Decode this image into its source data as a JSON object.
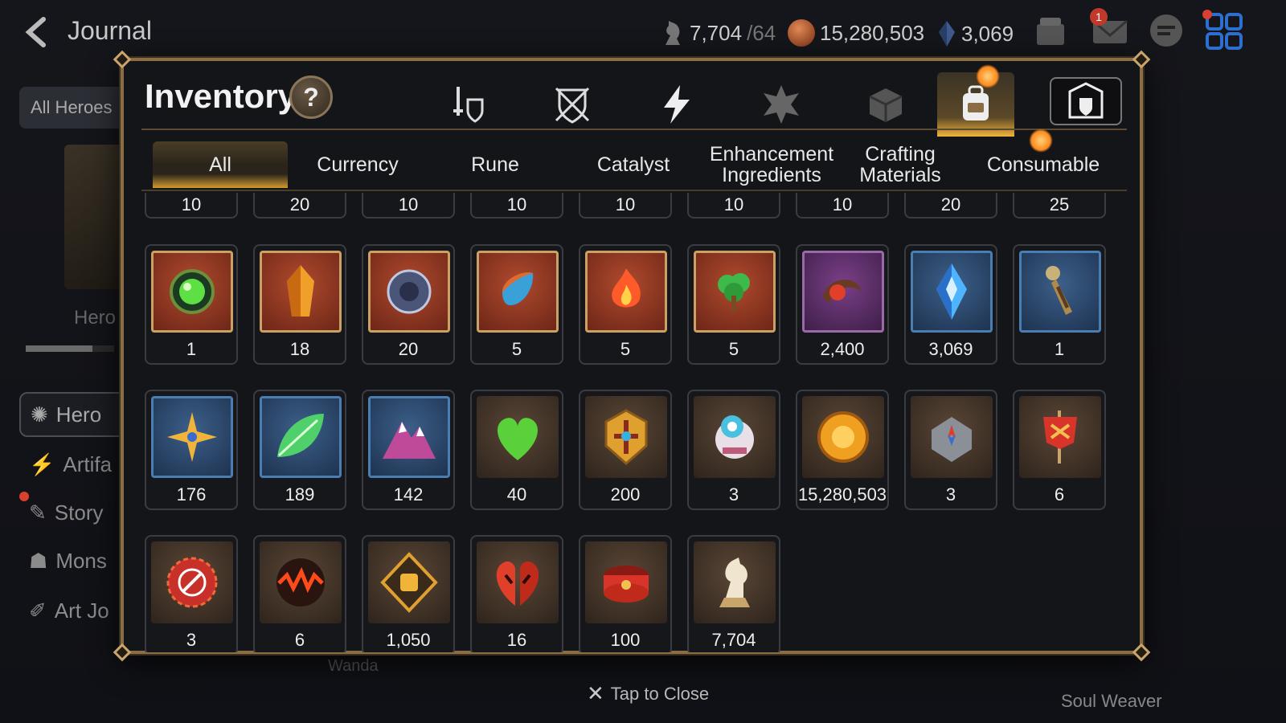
{
  "header": {
    "title": "Journal",
    "resources": [
      {
        "name": "skystone-like",
        "value": "7,704",
        "suffix": "/64",
        "icon": "horse-icon"
      },
      {
        "name": "gold",
        "value": "15,280,503",
        "icon": "gold-coin-icon"
      },
      {
        "name": "crystal",
        "value": "3,069",
        "icon": "crystal-icon"
      }
    ],
    "mail_badge": "1"
  },
  "background": {
    "all_heroes": "All Heroes",
    "hero_label": "Hero",
    "sidebar": [
      {
        "label": "Hero",
        "icon": "hero-icon"
      },
      {
        "label": "Artifa",
        "icon": "artifact-icon"
      },
      {
        "label": "Story",
        "icon": "story-icon"
      },
      {
        "label": "Mons",
        "icon": "monster-icon"
      },
      {
        "label": "Art Jo",
        "icon": "art-icon"
      }
    ],
    "wanda": "Wanda",
    "soul_weaver": "Soul Weaver",
    "tap_close": "Tap to Close"
  },
  "modal": {
    "title": "Inventory",
    "help": "?",
    "categories": [
      {
        "name": "equipment",
        "icon": "sword-shield-icon"
      },
      {
        "name": "gear",
        "icon": "crossed-shield-icon"
      },
      {
        "name": "artifact",
        "icon": "lightning-icon"
      },
      {
        "name": "material",
        "icon": "crest-icon"
      },
      {
        "name": "box",
        "icon": "cube-icon"
      },
      {
        "name": "bag",
        "icon": "backpack-icon",
        "active": true
      },
      {
        "name": "storage",
        "icon": "castle-shield-icon"
      }
    ],
    "tabs": [
      {
        "label": "All",
        "active": true
      },
      {
        "label": "Currency"
      },
      {
        "label": "Rune"
      },
      {
        "label": "Catalyst"
      },
      {
        "label": "Enhancement Ingredients"
      },
      {
        "label": "Crafting Materials"
      },
      {
        "label": "Consumable"
      }
    ],
    "top_row": [
      "10",
      "20",
      "10",
      "10",
      "10",
      "10",
      "10",
      "20",
      "25"
    ],
    "items": [
      {
        "qty": "1",
        "bg": "red",
        "frame": "gold",
        "icon": "green-orb-icon"
      },
      {
        "qty": "18",
        "bg": "red",
        "frame": "gold",
        "icon": "flame-crystal-icon"
      },
      {
        "qty": "20",
        "bg": "red",
        "frame": "gold",
        "icon": "rune-ring-icon"
      },
      {
        "qty": "5",
        "bg": "red",
        "frame": "gold",
        "icon": "water-drop-pendant-icon"
      },
      {
        "qty": "5",
        "bg": "red",
        "frame": "gold",
        "icon": "fire-pendant-icon"
      },
      {
        "qty": "5",
        "bg": "red",
        "frame": "gold",
        "icon": "tree-pendant-icon"
      },
      {
        "qty": "2,400",
        "bg": "purple",
        "frame": "purple",
        "icon": "red-amulet-icon"
      },
      {
        "qty": "3,069",
        "bg": "blue",
        "frame": "blue",
        "icon": "blue-crystal-icon"
      },
      {
        "qty": "1",
        "bg": "blue",
        "frame": "blue",
        "icon": "dagger-icon"
      },
      {
        "qty": "176",
        "bg": "blue",
        "frame": "blue",
        "icon": "star-pendant-icon"
      },
      {
        "qty": "189",
        "bg": "blue",
        "frame": "blue",
        "icon": "leaf-icon"
      },
      {
        "qty": "142",
        "bg": "blue",
        "frame": "blue",
        "icon": "mountain-icon"
      },
      {
        "qty": "40",
        "bg": "brown",
        "frame": "none",
        "icon": "heart-icon"
      },
      {
        "qty": "200",
        "bg": "brown",
        "frame": "none",
        "icon": "gold-emblem-icon"
      },
      {
        "qty": "3",
        "bg": "brown",
        "frame": "none",
        "icon": "orb-robot-icon"
      },
      {
        "qty": "15,280,503",
        "bg": "brown",
        "frame": "none",
        "icon": "gold-coin-icon"
      },
      {
        "qty": "3",
        "bg": "brown",
        "frame": "none",
        "icon": "stone-compass-icon"
      },
      {
        "qty": "6",
        "bg": "brown",
        "frame": "none",
        "icon": "banner-icon"
      },
      {
        "qty": "3",
        "bg": "brown",
        "frame": "none",
        "icon": "red-seal-icon"
      },
      {
        "qty": "6",
        "bg": "brown",
        "frame": "none",
        "icon": "lava-orb-icon"
      },
      {
        "qty": "1,050",
        "bg": "brown",
        "frame": "none",
        "icon": "fist-emblem-icon"
      },
      {
        "qty": "16",
        "bg": "brown",
        "frame": "none",
        "icon": "split-heart-icon"
      },
      {
        "qty": "100",
        "bg": "brown",
        "frame": "none",
        "icon": "red-band-icon"
      },
      {
        "qty": "7,704",
        "bg": "brown",
        "frame": "none",
        "icon": "horse-piece-icon"
      }
    ]
  },
  "colors": {
    "accent_gold": "#c9a46b",
    "active_tab_glow": "#f1b43b",
    "notification_dot": "#ff8a1e"
  }
}
